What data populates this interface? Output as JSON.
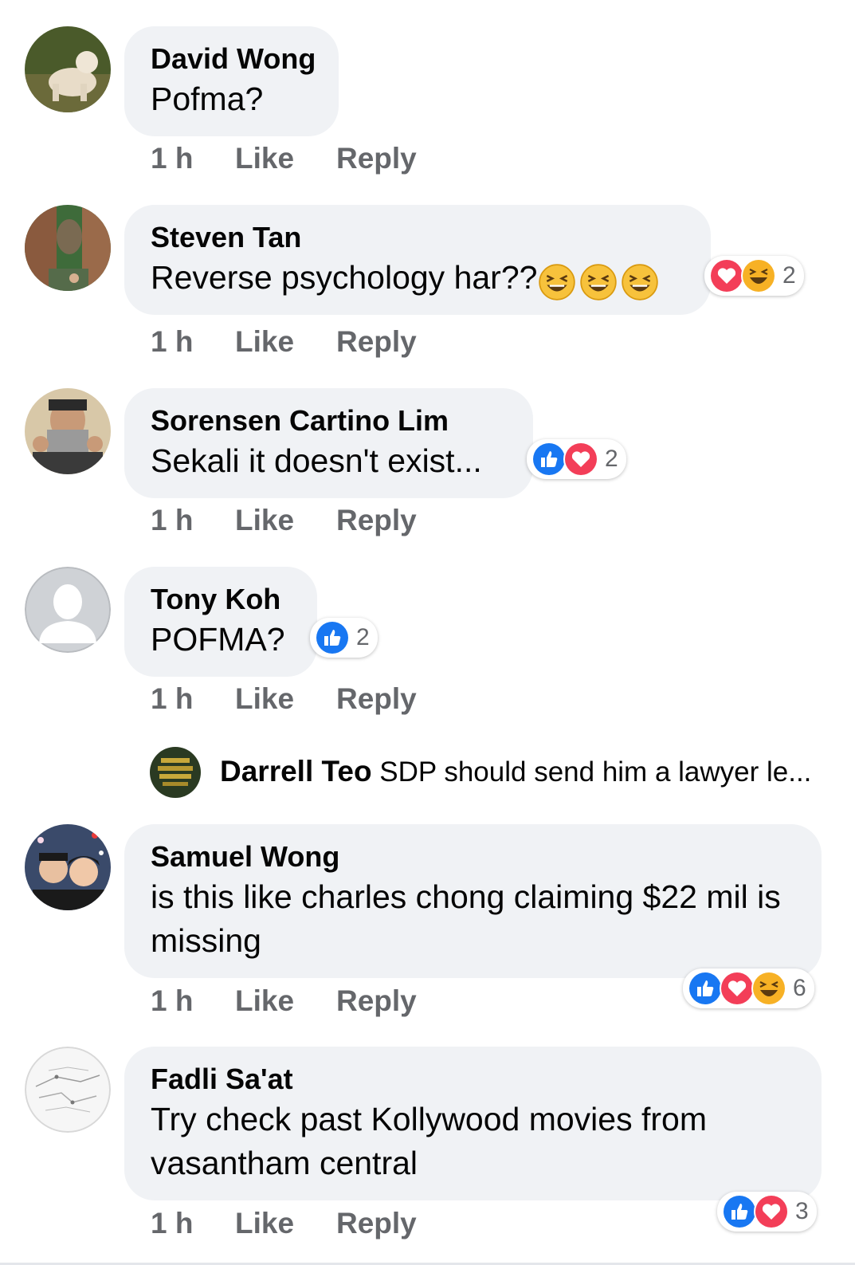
{
  "comments": [
    {
      "name": "David Wong",
      "text": "Pofma?",
      "time": "1 h",
      "like": "Like",
      "reply": "Reply"
    },
    {
      "name": "Steven Tan",
      "text": "Reverse psychology har??",
      "time": "1 h",
      "like": "Like",
      "reply": "Reply",
      "reaction_count": "2",
      "reactions": [
        "love",
        "haha"
      ]
    },
    {
      "name": "Sorensen Cartino Lim",
      "text": "Sekali it doesn't exist...",
      "time": "1 h",
      "like": "Like",
      "reply": "Reply",
      "reaction_count": "2",
      "reactions": [
        "like",
        "love"
      ]
    },
    {
      "name": "Tony Koh",
      "text": "POFMA?",
      "time": "1 h",
      "like": "Like",
      "reply": "Reply",
      "reaction_count": "2",
      "reactions": [
        "like"
      ]
    },
    {
      "name": "Samuel Wong",
      "text": "is this like charles chong claiming $22 mil is missing",
      "time": "1 h",
      "like": "Like",
      "reply": "Reply",
      "reaction_count": "6",
      "reactions": [
        "like",
        "love",
        "haha"
      ]
    },
    {
      "name": "Fadli Sa'at",
      "text": "Try check past Kollywood movies from vasantham central",
      "time": "1 h",
      "like": "Like",
      "reply": "Reply",
      "reaction_count": "3",
      "reactions": [
        "like",
        "love"
      ]
    }
  ],
  "reply_preview": {
    "name": "Darrell Teo",
    "text": "SDP should send him a lawyer le..."
  },
  "colors": {
    "like_blue": "#1877f2",
    "love_red": "#f33e58",
    "haha_yellow": "#f7b125",
    "bubble": "#f0f2f5",
    "meta_gray": "#65676b"
  }
}
